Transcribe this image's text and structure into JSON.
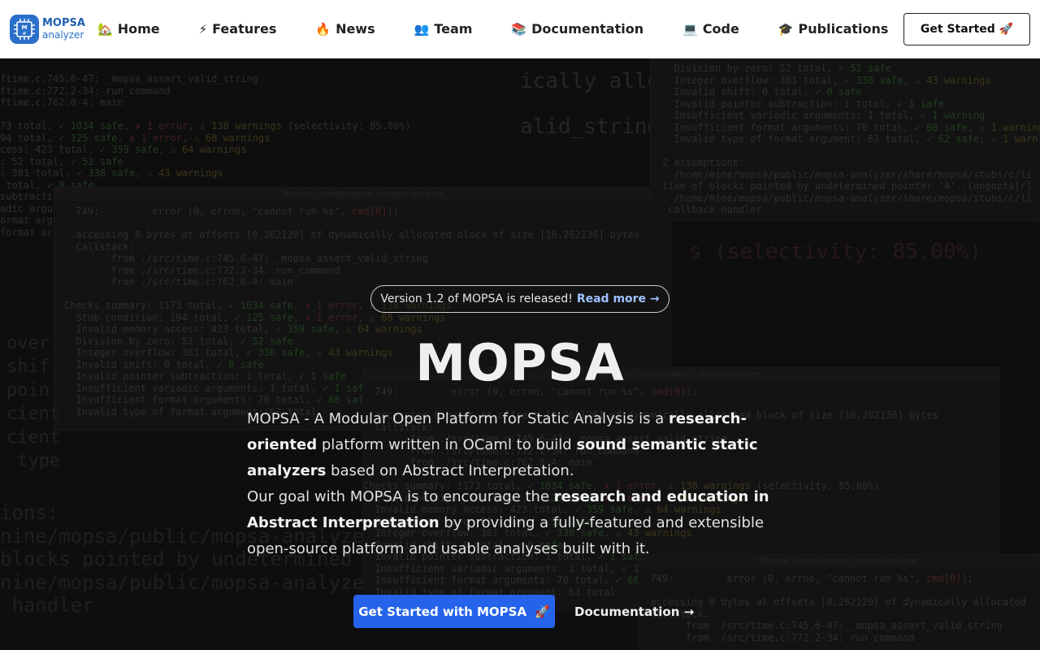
{
  "brand": {
    "line1": "MOPSA",
    "line2": "analyzer",
    "color": "#2a6fc9"
  },
  "nav": [
    {
      "icon": "🏡",
      "label": "Home"
    },
    {
      "icon": "⚡",
      "label": "Features"
    },
    {
      "icon": "🔥",
      "label": "News"
    },
    {
      "icon": "👥",
      "label": "Team"
    },
    {
      "icon": "📚",
      "label": "Documentation"
    },
    {
      "icon": "💻",
      "label": "Code"
    },
    {
      "icon": "🎓",
      "label": "Publications"
    }
  ],
  "header_cta": "Get Started 🚀",
  "announcement": {
    "text": "Version 1.2 of MOPSA is released!",
    "link": "Read more →"
  },
  "hero": {
    "title": "MOPSA",
    "p1_a": "MOPSA - A Modular Open Platform for Static Analysis is a ",
    "p1_b": "research-oriented",
    "p1_c": " platform written in OCaml to build ",
    "p1_d": "sound semantic static analyzers",
    "p1_e": " based on Abstract Interpretation.",
    "p2_a": "Our goal with MOPSA is to encourage the ",
    "p2_b": "research and education in Abstract Interpretation",
    "p2_c": " by providing a fully-featured and extensible open-source platform and usable analyses built with it."
  },
  "buttons": {
    "primary": "Get Started with MOPSA",
    "primary_icon": "🚀",
    "secondary": "Documentation →"
  },
  "accent_color": "#2563eb"
}
